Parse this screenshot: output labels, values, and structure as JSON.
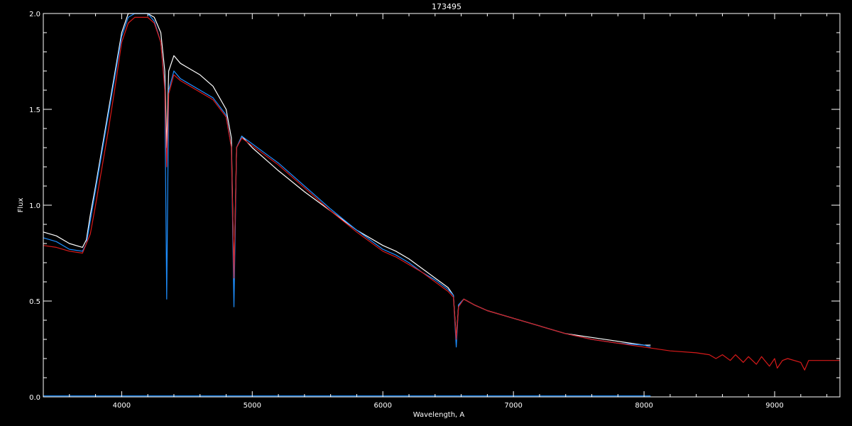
{
  "chart_data": {
    "type": "line",
    "title": "173495",
    "xlabel": "Wavelength, A",
    "ylabel": "Flux",
    "xlim": [
      3400,
      9500
    ],
    "ylim": [
      0.0,
      2.0
    ],
    "x_ticks": [
      {
        "value": 4000,
        "label": "4000"
      },
      {
        "value": 5000,
        "label": "5000"
      },
      {
        "value": 6000,
        "label": "6000"
      },
      {
        "value": 7000,
        "label": "7000"
      },
      {
        "value": 8000,
        "label": "8000"
      },
      {
        "value": 9000,
        "label": "9000"
      }
    ],
    "y_ticks": [
      {
        "value": 0.0,
        "label": "0.0"
      },
      {
        "value": 0.5,
        "label": "0.5"
      },
      {
        "value": 1.0,
        "label": "1.0"
      },
      {
        "value": 1.5,
        "label": "1.5"
      },
      {
        "value": 2.0,
        "label": "2.0"
      }
    ],
    "grid": false,
    "colors": {
      "background": "#000000",
      "axes": "#ffffff",
      "white_series": "#ffffff",
      "blue_series": "#1e8fff",
      "red_series": "#d81a1a"
    },
    "series": [
      {
        "color": "#ffffff",
        "x": [
          3400,
          3500,
          3600,
          3700,
          3730,
          3760,
          3800,
          3850,
          3900,
          3950,
          4000,
          4050,
          4100,
          4150,
          4200,
          4250,
          4300,
          4330,
          4345,
          4360,
          4400,
          4450,
          4500,
          4600,
          4700,
          4800,
          4840,
          4860,
          4880,
          4920,
          5000,
          5200,
          5400,
          5600,
          5800,
          6000,
          6100,
          6200,
          6300,
          6400,
          6500,
          6540,
          6562,
          6580,
          6620,
          6700,
          6800,
          7000,
          7200,
          7400,
          7600,
          7800,
          8000,
          8050
        ],
        "y": [
          0.86,
          0.84,
          0.8,
          0.78,
          0.82,
          0.95,
          1.1,
          1.3,
          1.5,
          1.7,
          1.9,
          2.0,
          2.02,
          2.02,
          2.02,
          1.98,
          1.9,
          1.7,
          1.3,
          1.7,
          1.78,
          1.74,
          1.72,
          1.68,
          1.62,
          1.5,
          1.35,
          0.6,
          1.3,
          1.36,
          1.3,
          1.18,
          1.07,
          0.97,
          0.87,
          0.79,
          0.76,
          0.72,
          0.67,
          0.62,
          0.57,
          0.53,
          0.3,
          0.48,
          0.51,
          0.48,
          0.45,
          0.41,
          0.37,
          0.33,
          0.31,
          0.29,
          0.27,
          0.27
        ]
      },
      {
        "color": "#1e8fff",
        "x": [
          3400,
          3500,
          3600,
          3700,
          3730,
          3760,
          3800,
          3850,
          3900,
          3950,
          4000,
          4050,
          4100,
          4150,
          4200,
          4250,
          4300,
          4330,
          4345,
          4360,
          4400,
          4450,
          4500,
          4600,
          4700,
          4800,
          4840,
          4860,
          4880,
          4920,
          5000,
          5200,
          5400,
          5600,
          5800,
          6000,
          6100,
          6200,
          6300,
          6400,
          6500,
          6540,
          6562,
          6580,
          6620,
          6700,
          6800,
          7000,
          7200,
          7400,
          7600,
          7800,
          8000,
          8050
        ],
        "y": [
          0.83,
          0.81,
          0.77,
          0.76,
          0.8,
          0.92,
          1.08,
          1.28,
          1.48,
          1.68,
          1.88,
          1.98,
          2.0,
          2.0,
          2.0,
          1.96,
          1.85,
          1.62,
          0.51,
          1.6,
          1.7,
          1.66,
          1.64,
          1.6,
          1.56,
          1.47,
          1.3,
          0.47,
          1.3,
          1.36,
          1.32,
          1.22,
          1.1,
          0.98,
          0.87,
          0.77,
          0.74,
          0.7,
          0.65,
          0.61,
          0.56,
          0.53,
          0.26,
          0.48,
          0.51,
          0.48,
          0.45,
          0.41,
          0.37,
          0.33,
          0.3,
          0.28,
          0.27,
          0.26
        ]
      },
      {
        "color": "#d81a1a",
        "x": [
          3400,
          3500,
          3600,
          3700,
          3760,
          3800,
          3850,
          3900,
          3950,
          4000,
          4050,
          4100,
          4150,
          4200,
          4250,
          4300,
          4330,
          4345,
          4360,
          4400,
          4450,
          4500,
          4600,
          4700,
          4800,
          4840,
          4860,
          4880,
          4920,
          5000,
          5200,
          5400,
          5600,
          5800,
          6000,
          6100,
          6200,
          6300,
          6400,
          6500,
          6540,
          6562,
          6580,
          6620,
          6700,
          6800,
          7000,
          7200,
          7400,
          7600,
          7800,
          8000,
          8200,
          8400,
          8500,
          8550,
          8600,
          8660,
          8700,
          8760,
          8800,
          8860,
          8900,
          8960,
          9000,
          9020,
          9060,
          9100,
          9200,
          9230,
          9260,
          9300,
          9400,
          9500
        ],
        "y": [
          0.79,
          0.78,
          0.76,
          0.75,
          0.85,
          1.0,
          1.2,
          1.4,
          1.62,
          1.85,
          1.95,
          1.98,
          1.98,
          1.98,
          1.95,
          1.85,
          1.6,
          1.2,
          1.58,
          1.68,
          1.65,
          1.63,
          1.59,
          1.55,
          1.46,
          1.3,
          0.62,
          1.3,
          1.35,
          1.31,
          1.21,
          1.09,
          0.97,
          0.86,
          0.76,
          0.73,
          0.69,
          0.65,
          0.6,
          0.55,
          0.52,
          0.3,
          0.47,
          0.51,
          0.48,
          0.45,
          0.41,
          0.37,
          0.33,
          0.3,
          0.28,
          0.26,
          0.24,
          0.23,
          0.22,
          0.2,
          0.22,
          0.19,
          0.22,
          0.18,
          0.21,
          0.17,
          0.21,
          0.16,
          0.2,
          0.15,
          0.19,
          0.2,
          0.18,
          0.14,
          0.19,
          0.19,
          0.19,
          0.19
        ]
      },
      {
        "color": "#1e8fff",
        "x": [
          3400,
          8050
        ],
        "y": [
          0.005,
          0.005
        ]
      }
    ]
  }
}
